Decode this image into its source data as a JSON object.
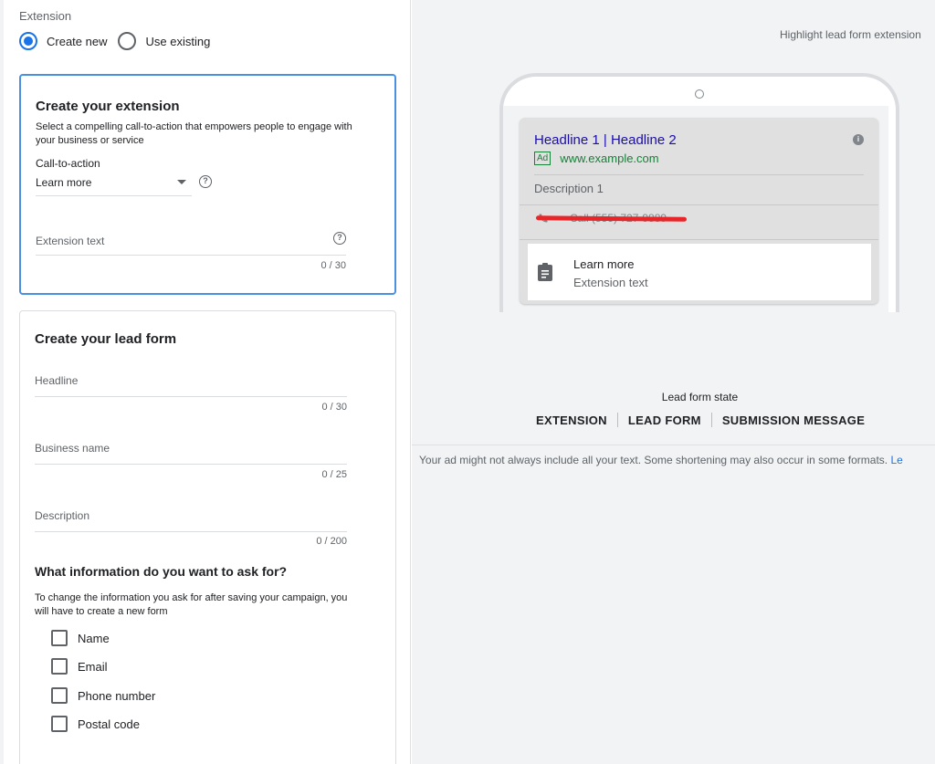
{
  "extension": {
    "section_label": "Extension",
    "options": [
      {
        "label": "Create new",
        "checked": true
      },
      {
        "label": "Use existing",
        "checked": false
      }
    ]
  },
  "create_extension": {
    "title": "Create your extension",
    "subtitle": "Select a compelling call-to-action that empowers people to engage with your business or service",
    "cta_label": "Call-to-action",
    "cta_value": "Learn more",
    "ext_text_placeholder": "Extension text",
    "ext_text_counter": "0 / 30"
  },
  "lead_form": {
    "title": "Create your lead form",
    "headline_placeholder": "Headline",
    "headline_counter": "0 / 30",
    "business_placeholder": "Business name",
    "business_counter": "0 / 25",
    "description_placeholder": "Description",
    "description_counter": "0 / 200",
    "question_title": "What information do you want to ask for?",
    "question_sub": "To change the information you ask for after saving your campaign, you will have to create a new form",
    "checkboxes": [
      {
        "label": "Name"
      },
      {
        "label": "Email"
      },
      {
        "label": "Phone number"
      },
      {
        "label": "Postal code"
      }
    ]
  },
  "preview": {
    "highlight_label": "Highlight lead form extension",
    "ad_headline": "Headline 1 | Headline 2",
    "ad_badge": "Ad",
    "ad_url": "www.example.com",
    "ad_description": "Description 1",
    "ad_call": "Call (555) 727-9889",
    "ext_title": "Learn more",
    "ext_text": "Extension text",
    "state_label": "Lead form state",
    "tabs": [
      "EXTENSION",
      "LEAD FORM",
      "SUBMISSION MESSAGE"
    ],
    "note": "Your ad might not always include all your text. Some shortening may also occur in some formats. ",
    "note_link": "Le"
  },
  "colors": {
    "accent": "#1a73e8",
    "active_card_border": "#4a90e2",
    "ad_headline": "#1a0dab",
    "ad_url": "#188038",
    "redaction": "#e8262a"
  }
}
